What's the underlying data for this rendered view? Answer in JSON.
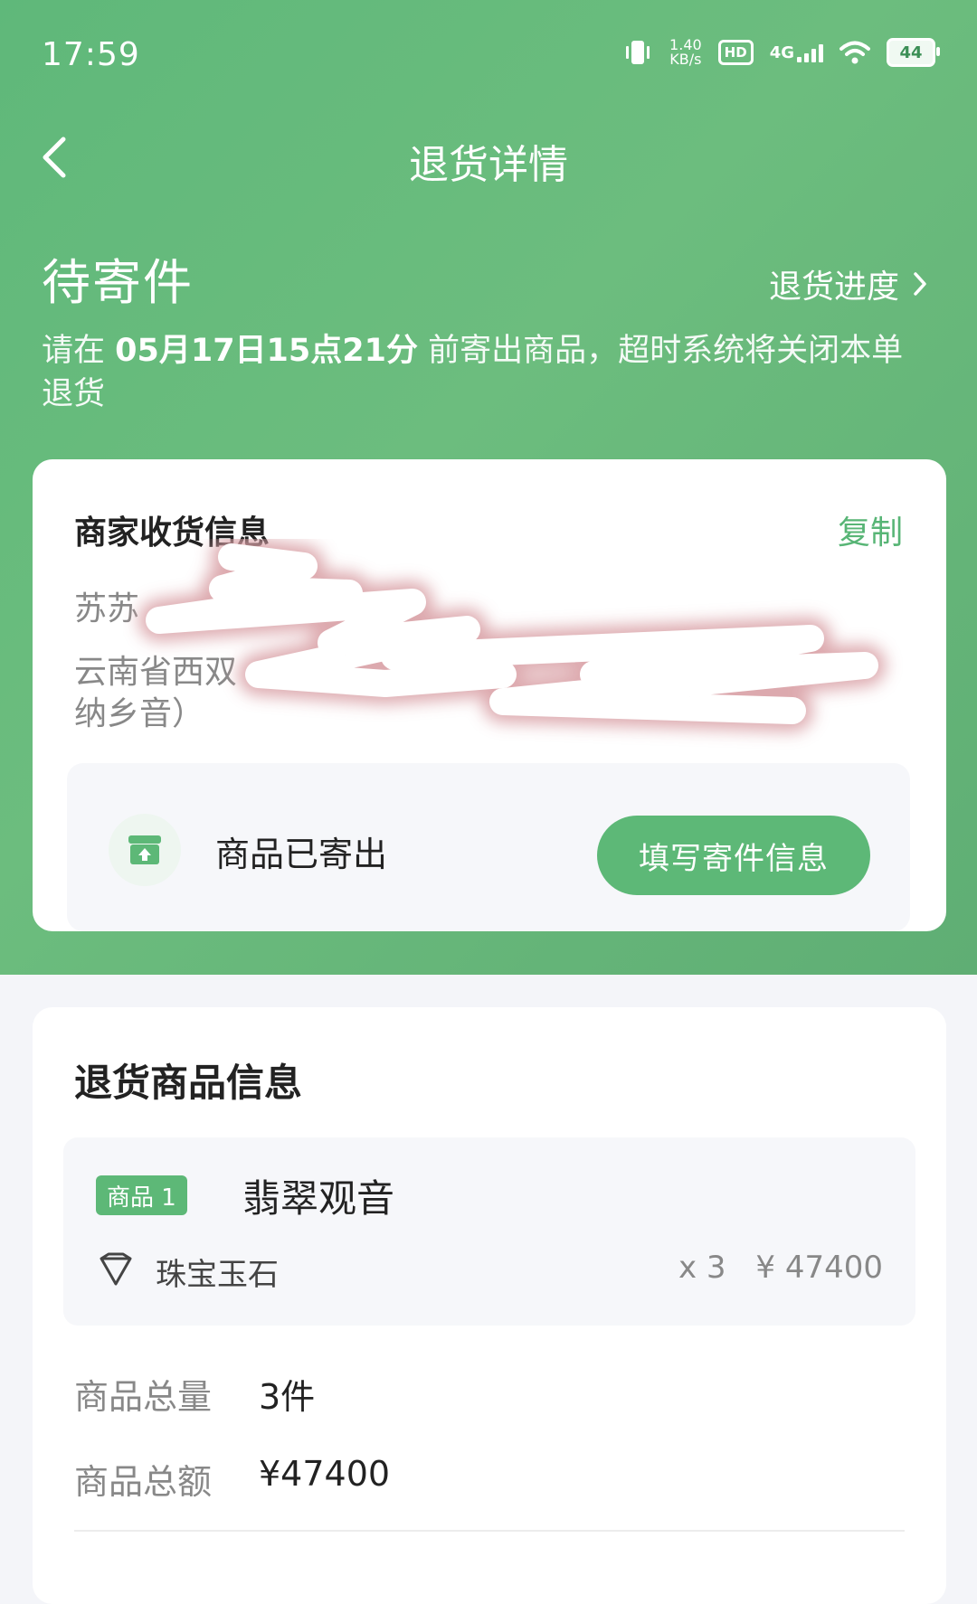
{
  "status_bar": {
    "time": "17:59",
    "net_speed_value": "1.40",
    "net_speed_unit": "KB/s",
    "hd": "HD",
    "network": "4G",
    "battery": "44"
  },
  "header": {
    "title": "退货详情",
    "back_icon": "chevron-left-icon"
  },
  "status": {
    "state": "待寄件",
    "progress_link": "退货进度",
    "deadline_prefix": "请在 ",
    "deadline_time": "05月17日15点21分",
    "deadline_suffix": " 前寄出商品，超时系统将关闭本单退货"
  },
  "merchant": {
    "title": "商家收货信息",
    "copy": "复制",
    "name_visible": "苏苏",
    "address_visible_1": "云南省西双",
    "address_visible_2": "纳乡音）",
    "shipped_label": "商品已寄出",
    "fill_button": "填写寄件信息"
  },
  "goods": {
    "title": "退货商品信息",
    "items": [
      {
        "tag": "商品 1",
        "name": "翡翠观音",
        "category": "珠宝玉石",
        "qty": "x 3",
        "price": "¥ 47400"
      }
    ],
    "summary": {
      "qty_label": "商品总量",
      "qty_value": "3件",
      "amount_label": "商品总额",
      "amount_value": "¥47400"
    }
  },
  "colors": {
    "brand_green": "#5db877",
    "hero_bg": "#63b87a"
  }
}
